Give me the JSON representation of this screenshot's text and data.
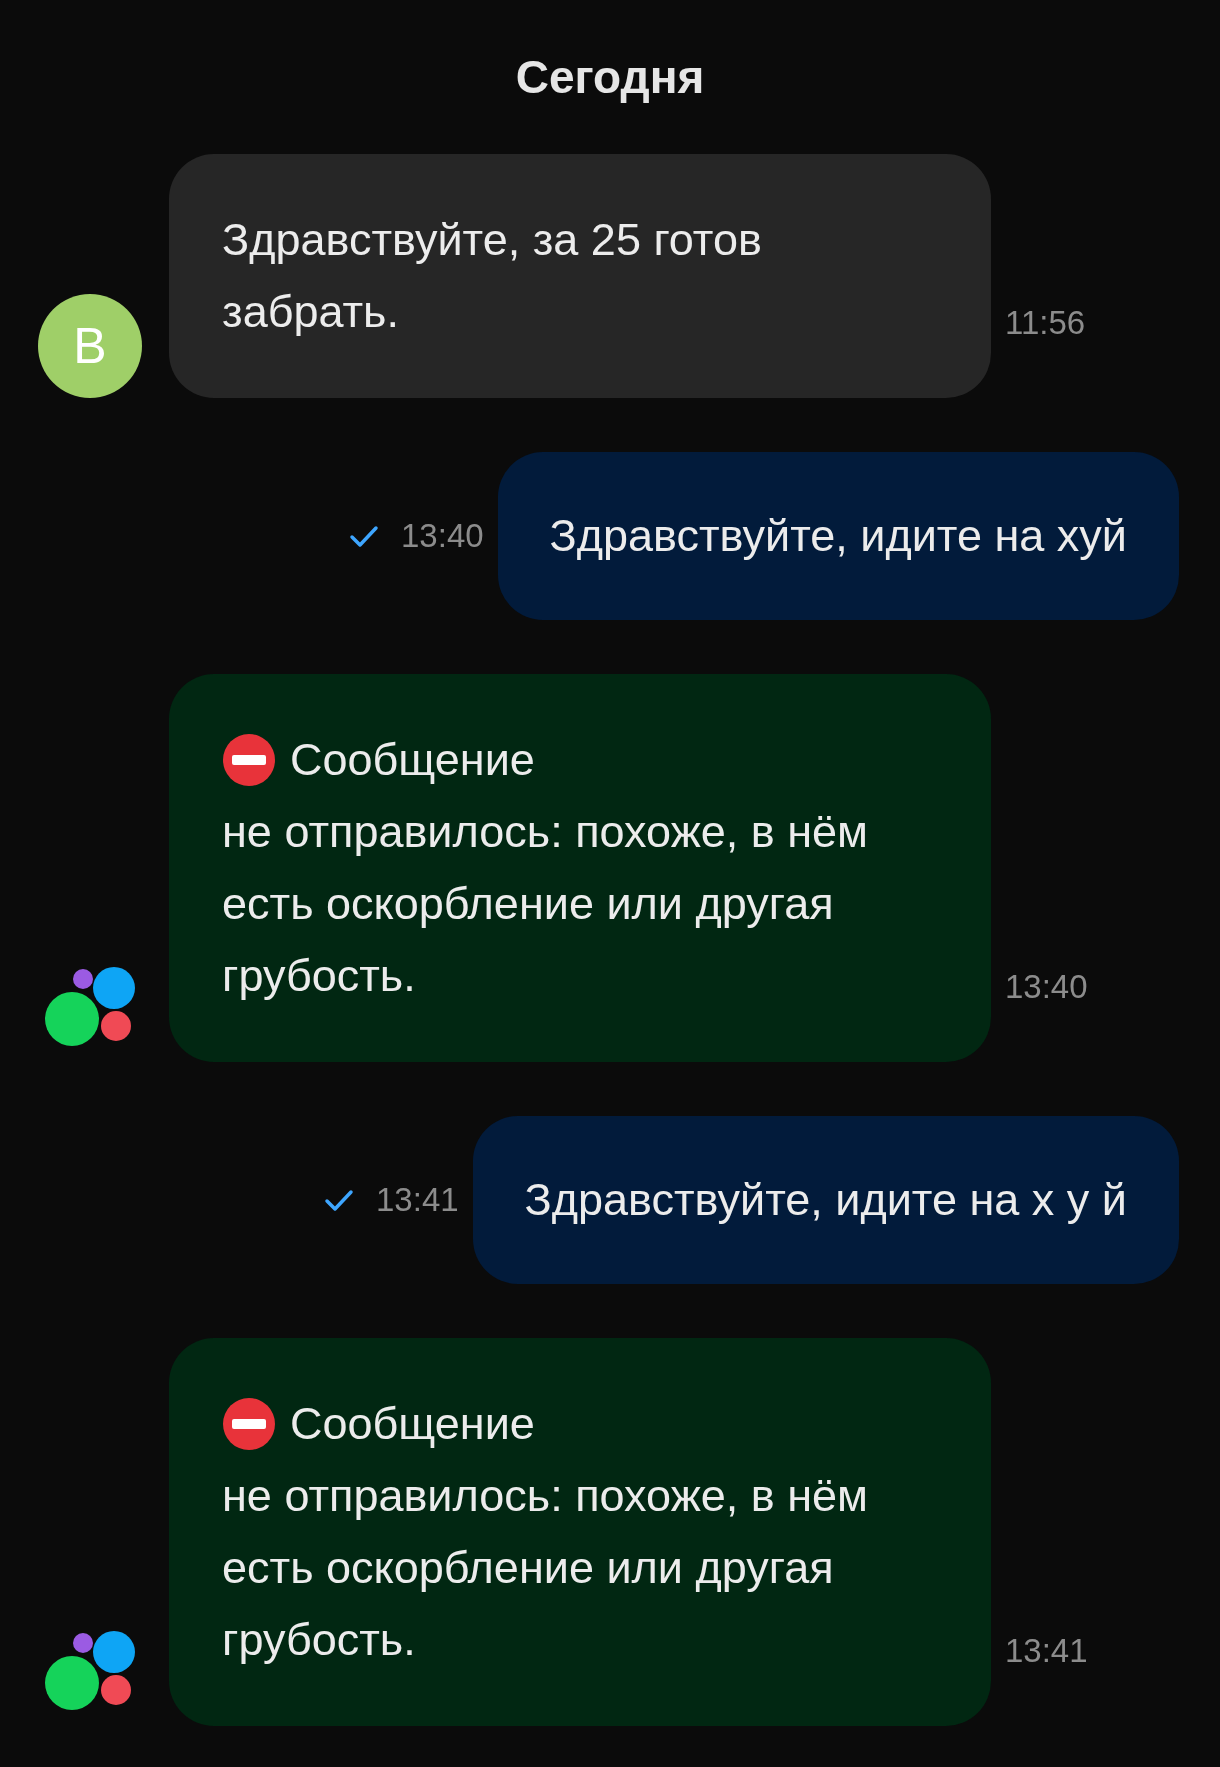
{
  "date_header": "Сегодня",
  "messages": [
    {
      "kind": "incoming",
      "text": "Здравствуйте, за 25 готов\nзабрать.",
      "time": "11:56",
      "avatar": {
        "kind": "letter",
        "text": "В"
      }
    },
    {
      "kind": "outgoing",
      "text": "Здравствуйте, идите на хуй",
      "time": "13:40",
      "sent": true
    },
    {
      "kind": "warning",
      "title": "Сообщение",
      "text": "не отправилось: похоже, в нём\nесть оскорбление или другая\nгрубость.",
      "time": "13:40",
      "avatar": {
        "kind": "logo"
      }
    },
    {
      "kind": "outgoing",
      "text": "Здравствуйте, идите на х у й",
      "time": "13:41",
      "sent": true
    },
    {
      "kind": "warning",
      "title": "Сообщение",
      "text": "не отправилось: похоже, в нём\nесть оскорбление или другая\nгрубость.",
      "time": "13:41",
      "avatar": {
        "kind": "logo"
      }
    }
  ]
}
